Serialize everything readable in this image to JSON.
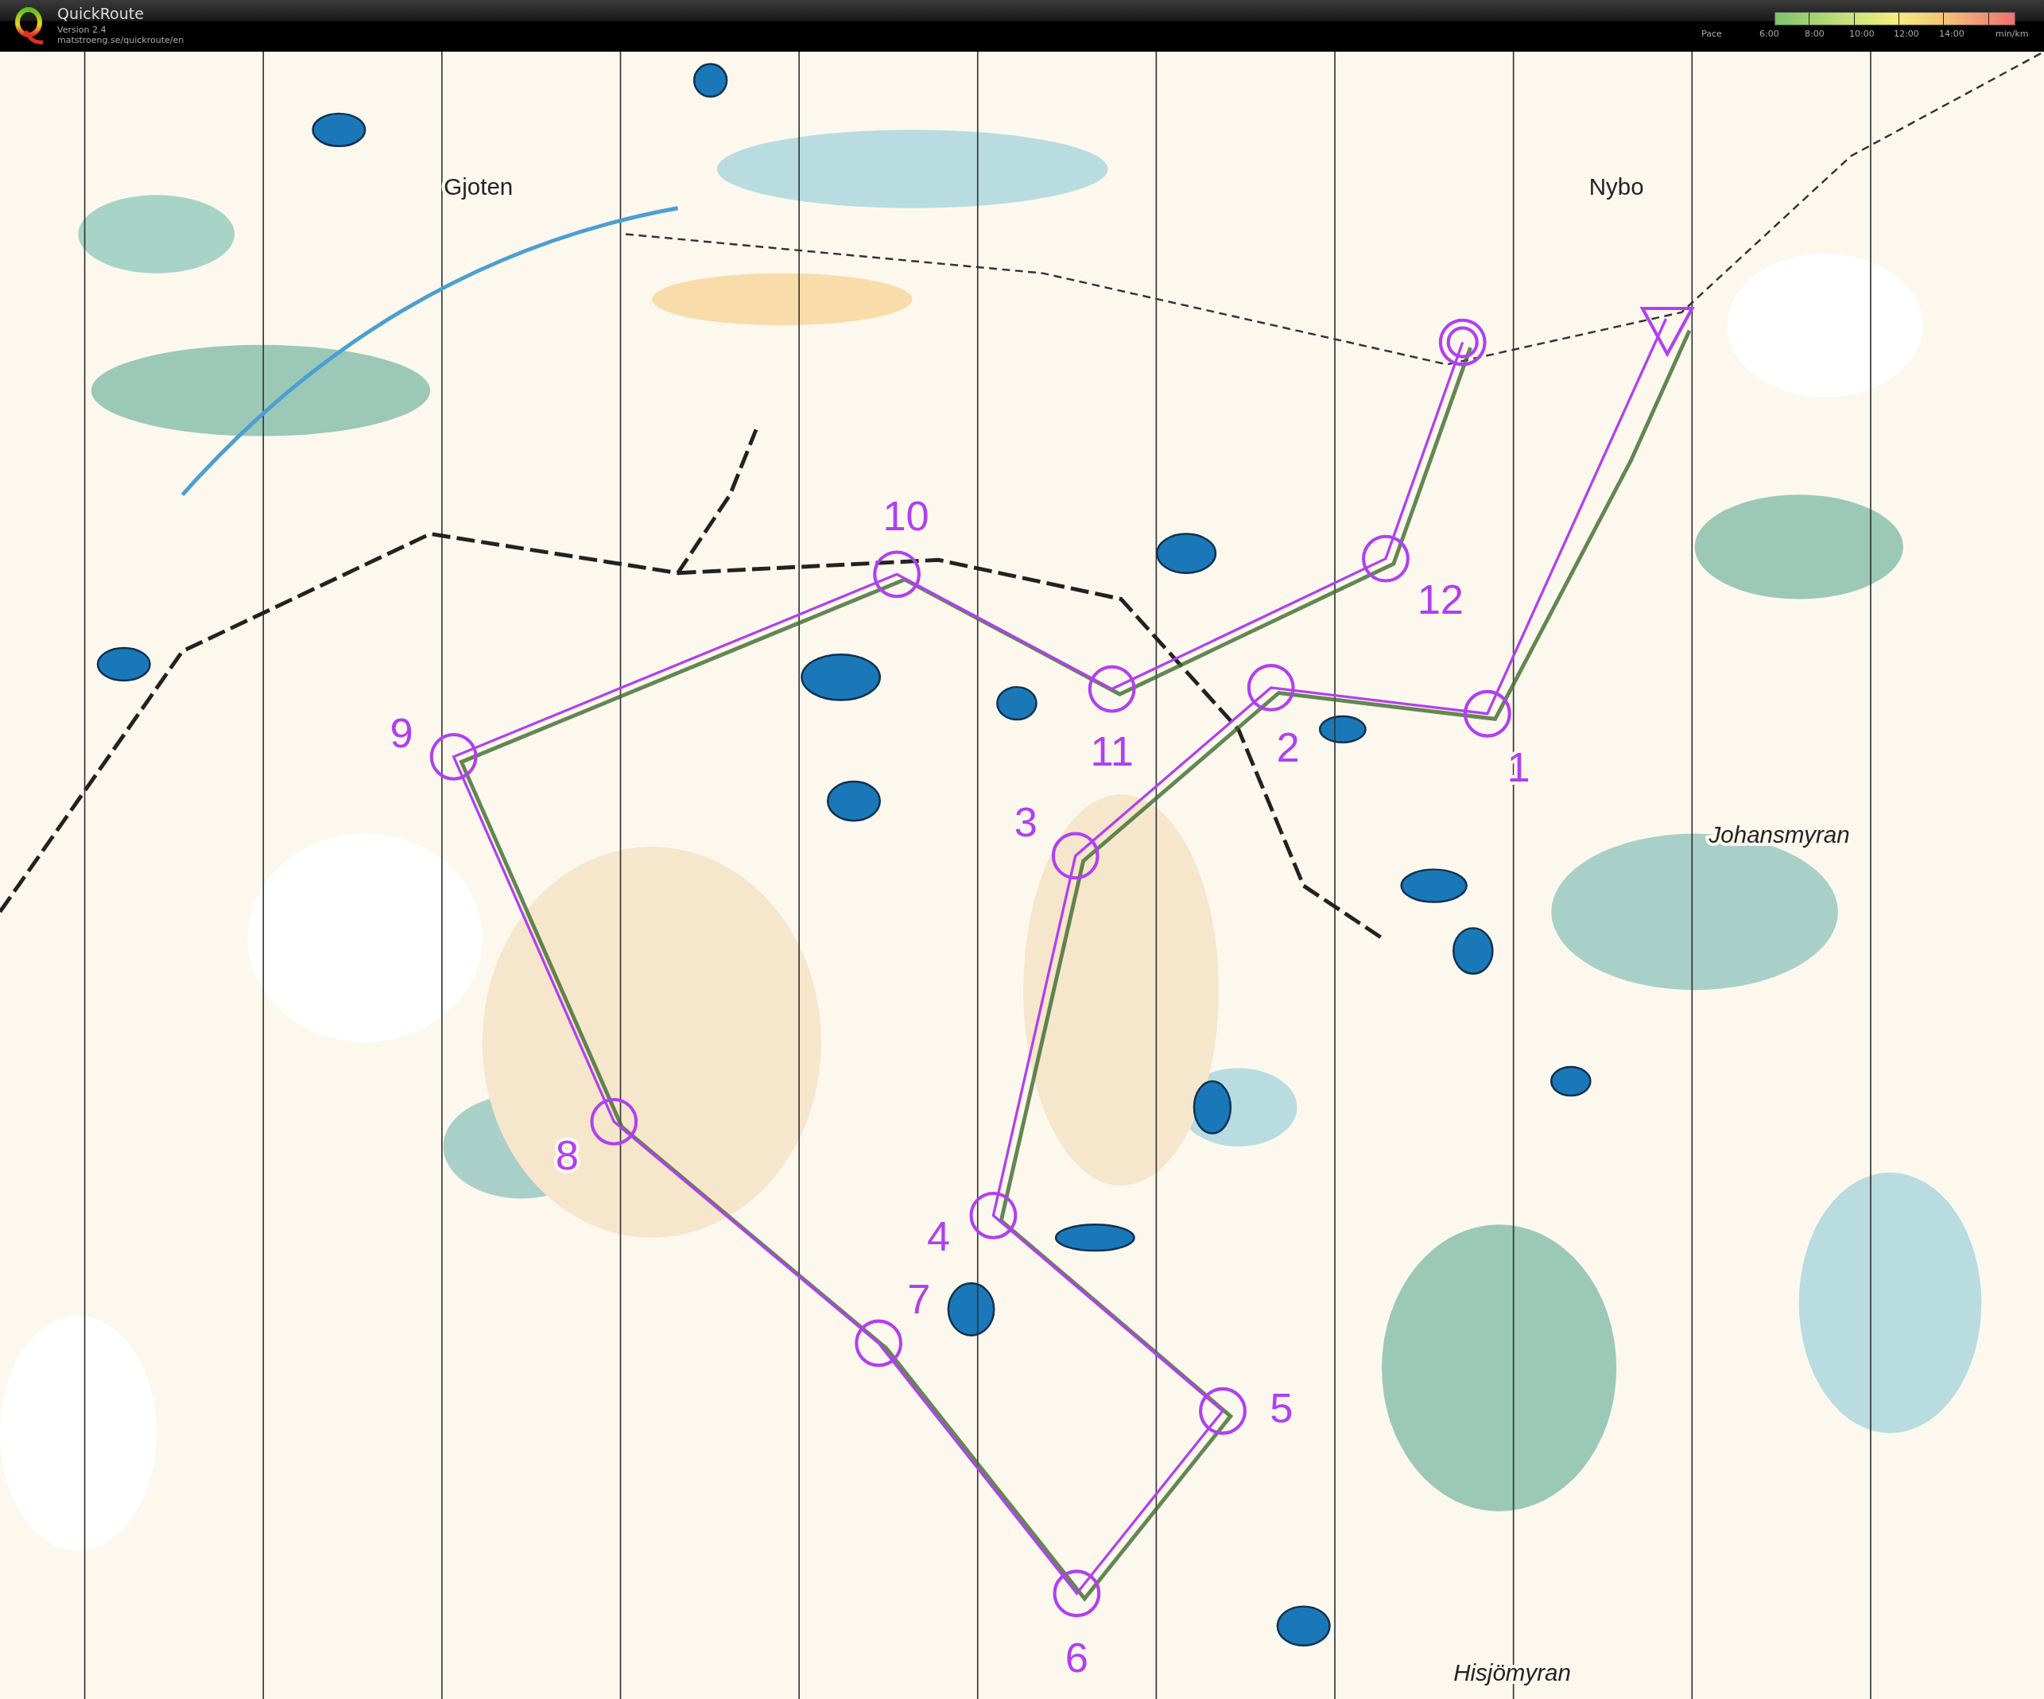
{
  "header": {
    "app_name": "QuickRoute",
    "version": "Version 2.4",
    "url": "matstroeng.se/quickroute/en"
  },
  "pace_legend": {
    "label": "Pace",
    "ticks": [
      "6:00",
      "8:00",
      "10:00",
      "12:00",
      "14:00"
    ],
    "unit": "min/km"
  },
  "map": {
    "place_names": [
      {
        "text": "Gjoten",
        "italic": false
      },
      {
        "text": "Nybo",
        "italic": false
      },
      {
        "text": "Johansmyran",
        "italic": true
      },
      {
        "text": "Hisjömyran",
        "italic": true
      }
    ],
    "controls": [
      {
        "label": "1"
      },
      {
        "label": "2"
      },
      {
        "label": "3"
      },
      {
        "label": "4"
      },
      {
        "label": "5"
      },
      {
        "label": "6"
      },
      {
        "label": "7"
      },
      {
        "label": "8"
      },
      {
        "label": "9"
      },
      {
        "label": "10"
      },
      {
        "label": "11"
      },
      {
        "label": "12"
      }
    ]
  }
}
